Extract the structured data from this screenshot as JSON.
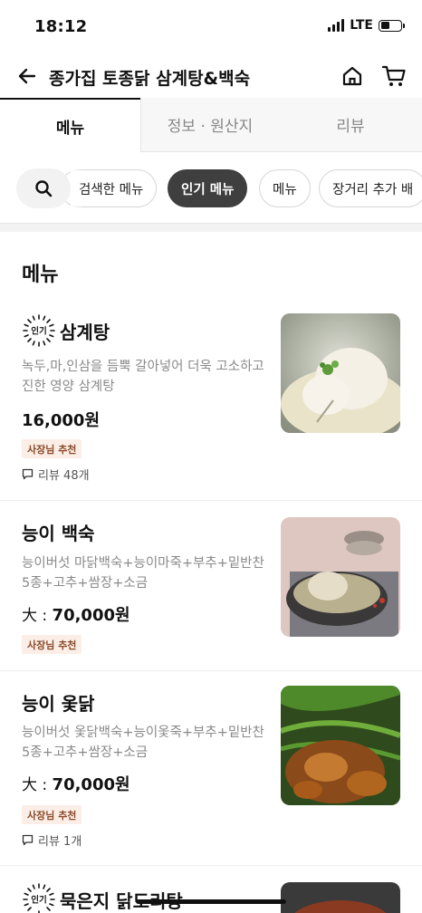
{
  "status": {
    "time": "18:12",
    "network": "LTE"
  },
  "header": {
    "title": "종가집 토종닭 삼계탕&백숙"
  },
  "tabs": [
    {
      "label": "메뉴"
    },
    {
      "label": "정보 · 원산지"
    },
    {
      "label": "리뷰"
    }
  ],
  "chips": [
    {
      "label": "검색한 메뉴"
    },
    {
      "label": "인기 메뉴"
    },
    {
      "label": "메뉴"
    },
    {
      "label": "장거리 추가 배"
    }
  ],
  "section": {
    "title": "메뉴"
  },
  "popular_badge": "인기",
  "items": [
    {
      "name": "삼계탕",
      "desc": "녹두,마,인삼을 듬뿍 갈아넣어 더욱 고소하고 진한 영양 삼계탕",
      "price_prefix": "",
      "price": "16,000원",
      "tag": "사장님 추천",
      "review": "리뷰 48개"
    },
    {
      "name": "능이 백숙",
      "desc": "능이버섯 마닭백숙+능이마죽+부추+밑반찬5종+고추+쌈장+소금",
      "price_prefix": "大 : ",
      "price": "70,000원",
      "tag": "사장님 추천",
      "review": ""
    },
    {
      "name": "능이 옻닭",
      "desc": "능이버섯 옻닭백숙+능이옻죽+부추+밑반찬5종+고추+쌈장+소금",
      "price_prefix": "大 : ",
      "price": "70,000원",
      "tag": "사장님 추천",
      "review": "리뷰 1개"
    },
    {
      "name": "묵은지 닭도리탕",
      "desc": "",
      "price_prefix": "",
      "price": "",
      "tag": "",
      "review": ""
    }
  ],
  "colors": {
    "tag_bg": "#fbeee6",
    "tag_text": "#8a4a2a",
    "selected_chip": "#3f3f3f"
  }
}
